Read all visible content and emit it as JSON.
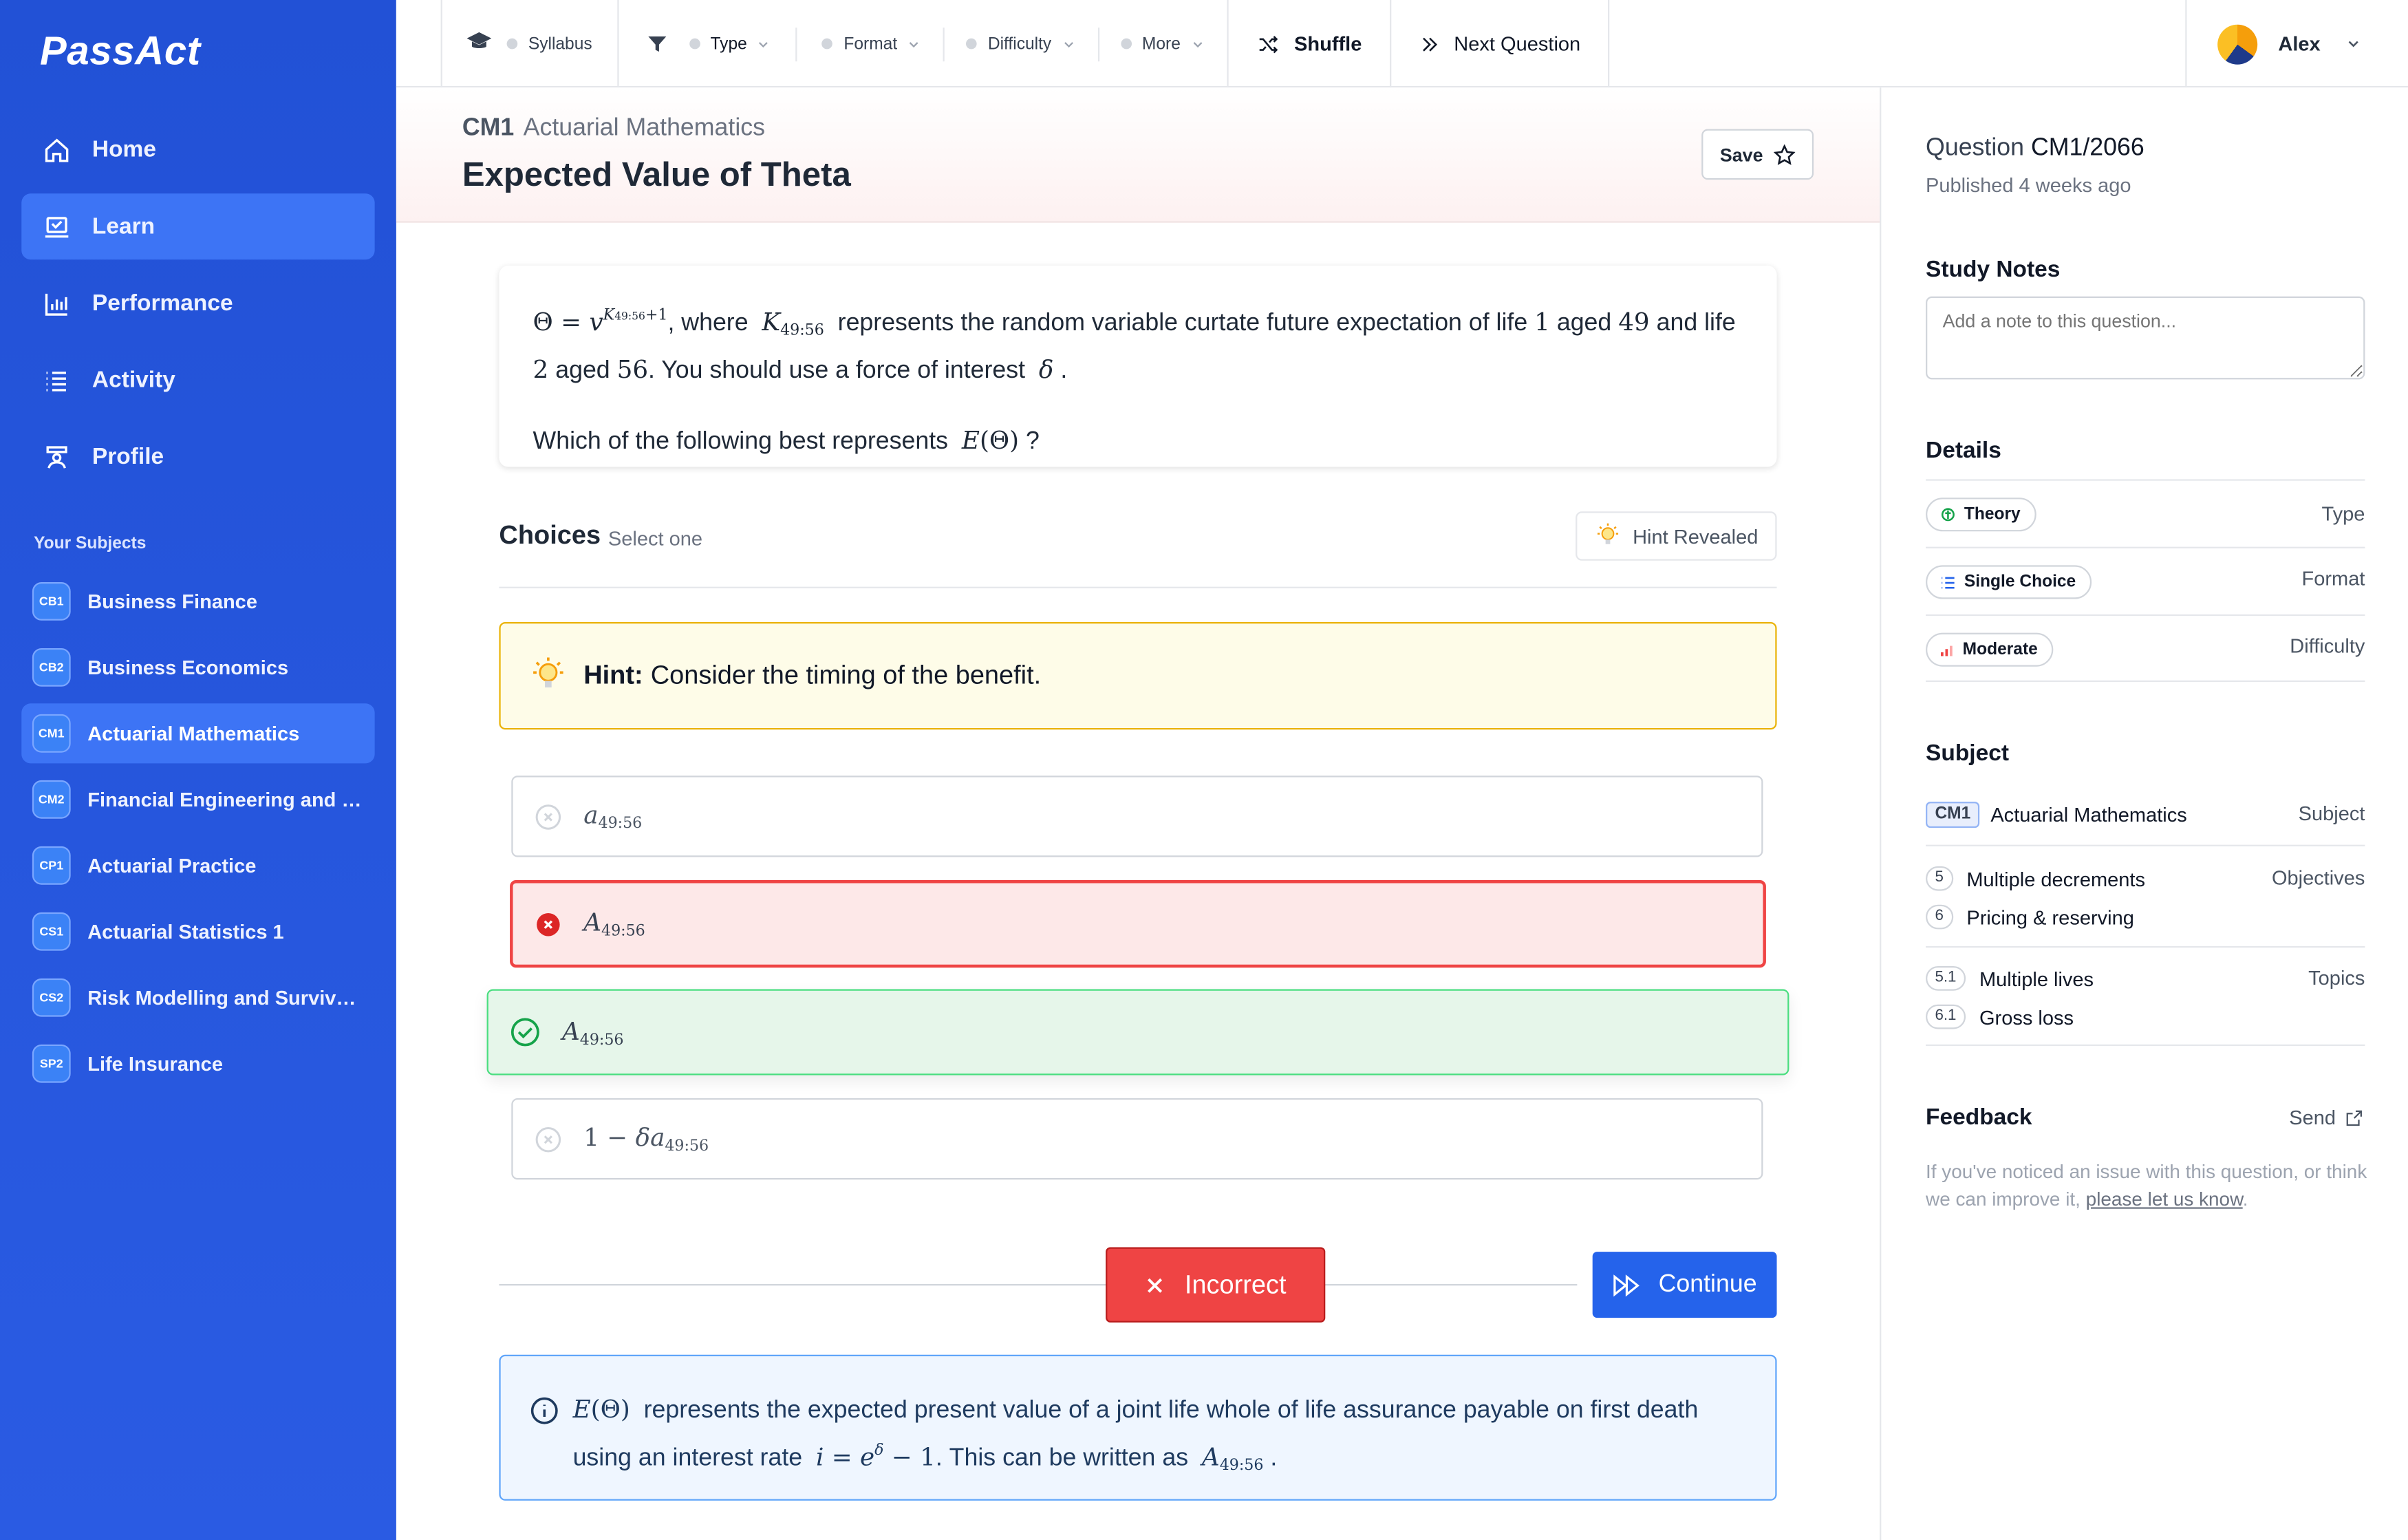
{
  "app": {
    "logo": "PassAct"
  },
  "nav": [
    {
      "label": "Home",
      "icon": "home-icon"
    },
    {
      "label": "Learn",
      "icon": "laptop-icon",
      "active": true
    },
    {
      "label": "Performance",
      "icon": "bar-chart-icon"
    },
    {
      "label": "Activity",
      "icon": "list-icon"
    },
    {
      "label": "Profile",
      "icon": "user-badge-icon"
    }
  ],
  "subjects_title": "Your Subjects",
  "subjects": [
    {
      "code": "CB1",
      "label": "Business Finance"
    },
    {
      "code": "CB2",
      "label": "Business Economics"
    },
    {
      "code": "CM1",
      "label": "Actuarial Mathematics",
      "active": true
    },
    {
      "code": "CM2",
      "label": "Financial Engineering and L..."
    },
    {
      "code": "CP1",
      "label": "Actuarial Practice"
    },
    {
      "code": "CS1",
      "label": "Actuarial Statistics 1"
    },
    {
      "code": "CS2",
      "label": "Risk Modelling and Survival..."
    },
    {
      "code": "SP2",
      "label": "Life Insurance"
    }
  ],
  "topbar": {
    "filters": [
      "Syllabus",
      "Type",
      "Format",
      "Difficulty",
      "More"
    ],
    "shuffle": "Shuffle",
    "next": "Next Question",
    "user": "Alex"
  },
  "header": {
    "code": "CM1",
    "subject": "Actuarial Mathematics",
    "title": "Expected Value of Theta",
    "save": "Save"
  },
  "question": {
    "t1": ", where",
    "t2": "represents the random variable curtate future expectation of life",
    "t3": "aged",
    "t4": "and life",
    "t5": "aged",
    "t6": ". You should use a force of interest",
    "t7": ".",
    "ask": "Which of the following best represents",
    "ask_end": "?"
  },
  "choices": {
    "title": "Choices",
    "sub": "Select one",
    "hint_button": "Hint Revealed",
    "hint_label": "Hint:",
    "hint_text": "Consider the timing of the benefit."
  },
  "result": {
    "incorrect": "Incorrect",
    "continue": "Continue"
  },
  "explanation": {
    "t1": "represents the expected present value of a joint life whole of life assurance payable on first death using an interest rate",
    "t2": ". This can be written as",
    "t3": "."
  },
  "panel": {
    "question_label": "Question",
    "question_id": "CM1/2066",
    "published": "Published 4 weeks ago",
    "notes_title": "Study Notes",
    "notes_placeholder": "Add a note to this question...",
    "details_title": "Details",
    "details": [
      {
        "pill": "Theory",
        "label": "Type",
        "icon": "brain-icon"
      },
      {
        "pill": "Single Choice",
        "label": "Format",
        "icon": "list-icon"
      },
      {
        "pill": "Moderate",
        "label": "Difficulty",
        "icon": "signal-icon"
      }
    ],
    "subject_title": "Subject",
    "subject_code": "CM1",
    "subject_name": "Actuarial Mathematics",
    "subject_label": "Subject",
    "objectives_label": "Objectives",
    "objectives": [
      {
        "num": "5",
        "label": "Multiple decrements"
      },
      {
        "num": "6",
        "label": "Pricing & reserving"
      }
    ],
    "topics_label": "Topics",
    "topics": [
      {
        "num": "5.1",
        "label": "Multiple lives"
      },
      {
        "num": "6.1",
        "label": "Gross loss"
      }
    ],
    "feedback_title": "Feedback",
    "feedback_send": "Send",
    "feedback_text": "If you've noticed an issue with this question, or think we can improve it,",
    "feedback_link": "please let us know",
    "feedback_end": "."
  },
  "colors": {
    "sidebar": "#2251d6",
    "active": "#3d74f5",
    "incorrect": "#ef4444",
    "correct_bg": "#e6f6ea",
    "primary": "#2563eb",
    "hint_bg": "#fefce8",
    "info_bg": "#eff6ff"
  }
}
